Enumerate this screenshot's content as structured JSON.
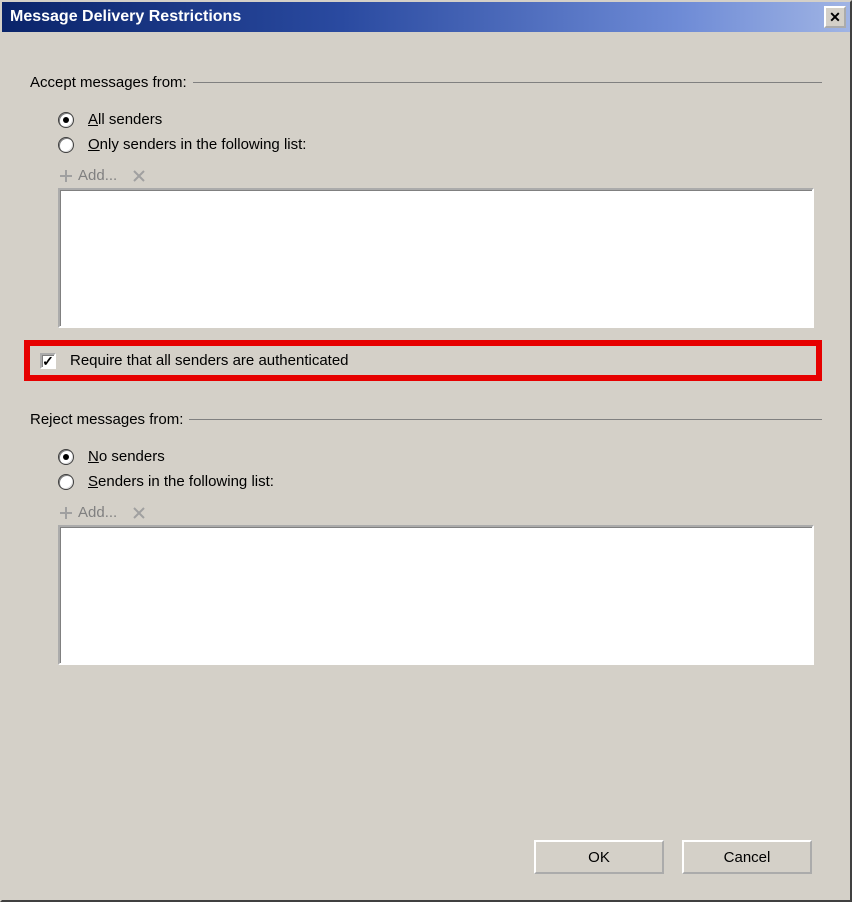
{
  "title": "Message Delivery Restrictions",
  "accept": {
    "legend": "Accept messages from:",
    "radio_all": "All senders",
    "radio_list_pre": "Only senders in the following list:",
    "add_label": "Add...",
    "selected": "all"
  },
  "require_auth": {
    "label": "Require that all senders are authenticated",
    "checked": true
  },
  "reject": {
    "legend": "Reject messages from:",
    "radio_none": "No senders",
    "radio_list_pre": "Senders in the following list:",
    "add_label": "Add...",
    "selected": "none"
  },
  "buttons": {
    "ok": "OK",
    "cancel": "Cancel"
  }
}
